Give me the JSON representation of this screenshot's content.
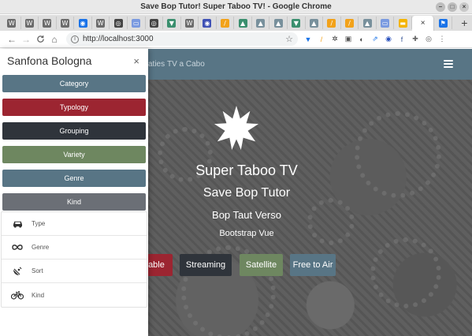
{
  "window": {
    "title": "Save Bop Tutor! Super Taboo TV! - Google Chrome",
    "controls": [
      "–",
      "□",
      "×"
    ]
  },
  "tabs": [
    {
      "icon": "W",
      "color": "#6b6b6b"
    },
    {
      "icon": "W",
      "color": "#6b6b6b"
    },
    {
      "icon": "W",
      "color": "#6b6b6b"
    },
    {
      "icon": "W",
      "color": "#6b6b6b"
    },
    {
      "icon": "◉",
      "color": "#1a73e8"
    },
    {
      "icon": "W",
      "color": "#6b6b6b"
    },
    {
      "icon": "◎",
      "color": "#444444"
    },
    {
      "icon": "▭",
      "color": "#7a9ae0"
    },
    {
      "icon": "◎",
      "color": "#444444"
    },
    {
      "icon": "▼",
      "color": "#3a8f6e"
    },
    {
      "icon": "W",
      "color": "#6b6b6b"
    },
    {
      "icon": "◉",
      "color": "#3f51b5"
    },
    {
      "icon": "/",
      "color": "#f2a21a"
    },
    {
      "icon": "▲",
      "color": "#3a8f6e"
    },
    {
      "icon": "▲",
      "color": "#78909c"
    },
    {
      "icon": "▲",
      "color": "#78909c"
    },
    {
      "icon": "▼",
      "color": "#3a8f6e"
    },
    {
      "icon": "▲",
      "color": "#78909c"
    },
    {
      "icon": "/",
      "color": "#f2a21a"
    },
    {
      "icon": "/",
      "color": "#f2a21a"
    },
    {
      "icon": "▲",
      "color": "#78909c"
    },
    {
      "icon": "▭",
      "color": "#7a9ae0"
    },
    {
      "icon": "▬",
      "color": "#f4b400"
    }
  ],
  "active_tab": {
    "close": "×"
  },
  "extra_tab": {
    "icon": "⚑",
    "color": "#1a73e8"
  },
  "new_tab": "+",
  "toolbar": {
    "back": "←",
    "forward": "→",
    "reload": "C",
    "home": "⌂",
    "url": "http://localhost:3000",
    "star": "☆",
    "extensions": [
      {
        "icon": "▼",
        "color": "#1a73e8"
      },
      {
        "icon": "/",
        "color": "#f2a21a"
      },
      {
        "icon": "✲",
        "color": "#333333"
      },
      {
        "icon": "▣",
        "color": "#555555"
      },
      {
        "icon": "◐",
        "color": "#444444"
      },
      {
        "icon": "⇗",
        "color": "#1a73e8"
      },
      {
        "icon": "◉",
        "color": "#2a52be"
      },
      {
        "icon": "f",
        "color": "#3b5998"
      },
      {
        "icon": "✚",
        "color": "#666666"
      },
      {
        "icon": "◎",
        "color": "#555555"
      },
      {
        "icon": "⋮",
        "color": "#555555"
      }
    ]
  },
  "navbar": {
    "links": [
      "aties",
      "TV a Cabo"
    ],
    "bg": "#587585"
  },
  "sidebar": {
    "title": "Sanfona Bologna",
    "close": "×",
    "buttons": [
      {
        "label": "Category",
        "color": "#587585"
      },
      {
        "label": "Typology",
        "color": "#9c2531"
      },
      {
        "label": "Grouping",
        "color": "#2f343b"
      },
      {
        "label": "Variety",
        "color": "#6e8760"
      },
      {
        "label": "Genre",
        "color": "#587585"
      },
      {
        "label": "Kind",
        "color": "#6b6f76"
      }
    ],
    "items": [
      {
        "label": "Type",
        "icon": "car-icon"
      },
      {
        "label": "Genre",
        "icon": "infinity-icon"
      },
      {
        "label": "Sort",
        "icon": "satellite-dish-icon"
      },
      {
        "label": "Kind",
        "icon": "bicycle-icon"
      }
    ]
  },
  "hero": {
    "title": "Super Taboo TV",
    "subtitle": "Save Bop Tutor",
    "tagline": "Bop Taut Verso",
    "framework": "Bootstrap Vue",
    "buttons": [
      {
        "label": "Cable",
        "color": "#9c2531"
      },
      {
        "label": "Streaming",
        "color": "#2f343b"
      },
      {
        "label": "Satellite",
        "color": "#6e8760"
      },
      {
        "label": "Free to Air",
        "color": "#587585"
      }
    ]
  }
}
